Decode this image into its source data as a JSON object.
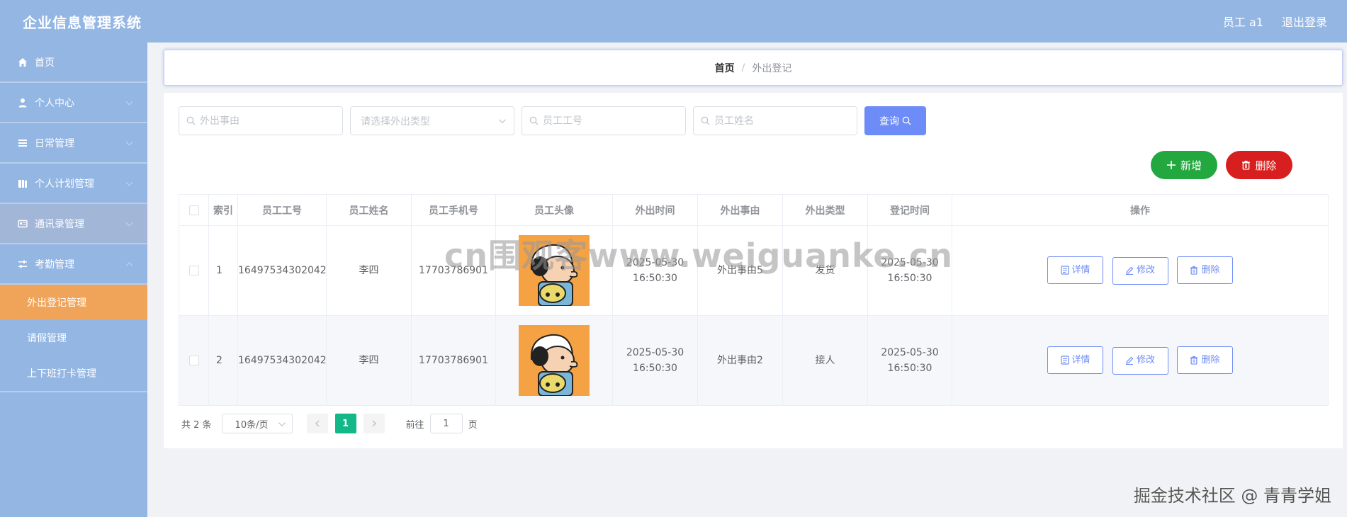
{
  "header": {
    "title": "企业信息管理系统",
    "user": "员工 a1",
    "logout": "退出登录"
  },
  "sidebar": {
    "items": [
      {
        "label": "首页",
        "icon": "home-icon"
      },
      {
        "label": "个人中心",
        "icon": "user-icon"
      },
      {
        "label": "日常管理",
        "icon": "list-icon"
      },
      {
        "label": "个人计划管理",
        "icon": "book-icon"
      },
      {
        "label": "通讯录管理",
        "icon": "contact-card-icon"
      },
      {
        "label": "考勤管理",
        "icon": "sliders-icon"
      }
    ],
    "subitems": [
      {
        "label": "外出登记管理",
        "active": true
      },
      {
        "label": "请假管理"
      },
      {
        "label": "上下班打卡管理"
      }
    ]
  },
  "breadcrumb": {
    "home": "首页",
    "sep": "/",
    "current": "外出登记"
  },
  "search": {
    "reason_placeholder": "外出事由",
    "type_placeholder": "请选择外出类型",
    "empno_placeholder": "员工工号",
    "name_placeholder": "员工姓名",
    "query_label": "查询"
  },
  "actions": {
    "add_label": "新增",
    "delete_label": "删除"
  },
  "table": {
    "headers": [
      "索引",
      "员工工号",
      "员工姓名",
      "员工手机号",
      "员工头像",
      "外出时间",
      "外出事由",
      "外出类型",
      "登记时间",
      "操作"
    ],
    "rows": [
      {
        "index": "1",
        "empno": "16497534302042",
        "name": "李四",
        "phone": "17703786901",
        "out_time": "2025-05-30 16:50:30",
        "reason": "外出事由5",
        "type": "发货",
        "reg_time": "2025-05-30 16:50:30"
      },
      {
        "index": "2",
        "empno": "16497534302042",
        "name": "李四",
        "phone": "17703786901",
        "out_time": "2025-05-30 16:50:30",
        "reason": "外出事由2",
        "type": "接人",
        "reg_time": "2025-05-30 16:50:30"
      }
    ],
    "row_actions": {
      "detail": "详情",
      "edit": "修改",
      "delete": "删除"
    }
  },
  "pagination": {
    "total": "共 2 条",
    "page_size": "10条/页",
    "current_page": "1",
    "goto_prefix": "前往",
    "goto_value": "1",
    "goto_suffix": "页"
  },
  "watermark": {
    "center": "cn围观客www.weiguanke.cn",
    "corner": "掘金技术社区 @ 青青学姐"
  },
  "colors": {
    "header_bg": "#94b6e3",
    "active_menu": "#f0a45a",
    "primary": "#6d8cf7",
    "success": "#23a73f",
    "danger": "#d71f1f",
    "page_active": "#13b888"
  }
}
